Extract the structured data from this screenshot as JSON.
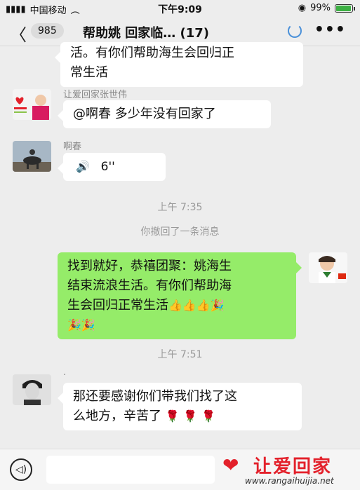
{
  "status_bar": {
    "carrier": "中国移动",
    "time": "下午9:09",
    "battery": "99%",
    "battery_level": 0.99
  },
  "nav": {
    "unread_count": "985",
    "title": "帮助姚  回家临… (17)"
  },
  "messages": [
    {
      "type": "text",
      "side": "left",
      "text_lines": [
        "活。有你们帮助海生会回归正",
        "常生活"
      ]
    },
    {
      "type": "text",
      "side": "left",
      "sender": "让爱回家张世伟",
      "text": "@啊春 多少年没有回家了"
    },
    {
      "type": "voice",
      "side": "left",
      "sender": "啊春",
      "duration": "6''"
    },
    {
      "type": "time",
      "text": "上午 7:35"
    },
    {
      "type": "system",
      "text": "你撤回了一条消息"
    },
    {
      "type": "text",
      "side": "right",
      "text_lines": [
        "找到就好，恭禧团聚：姚海生",
        "结束流浪生活。有你们帮助海",
        "生会回归正常生活"
      ],
      "emoji": [
        "👍",
        "👍",
        "👍",
        "🎉",
        "🎉",
        "🎉"
      ]
    },
    {
      "type": "time",
      "text": "上午 7:51"
    },
    {
      "type": "text",
      "side": "left",
      "sender": "·",
      "text_lines": [
        "那还要感谢你们带我们找了这",
        "么地方，辛苦了"
      ],
      "emoji": [
        "🌹",
        "🌹",
        "🌹"
      ]
    }
  ],
  "watermark": {
    "brand": "让爱回家",
    "url": "www.rangaihuijia.net"
  },
  "colors": {
    "my_bubble": "#95ec69",
    "their_bubble": "#ffffff",
    "background": "#ededed"
  }
}
